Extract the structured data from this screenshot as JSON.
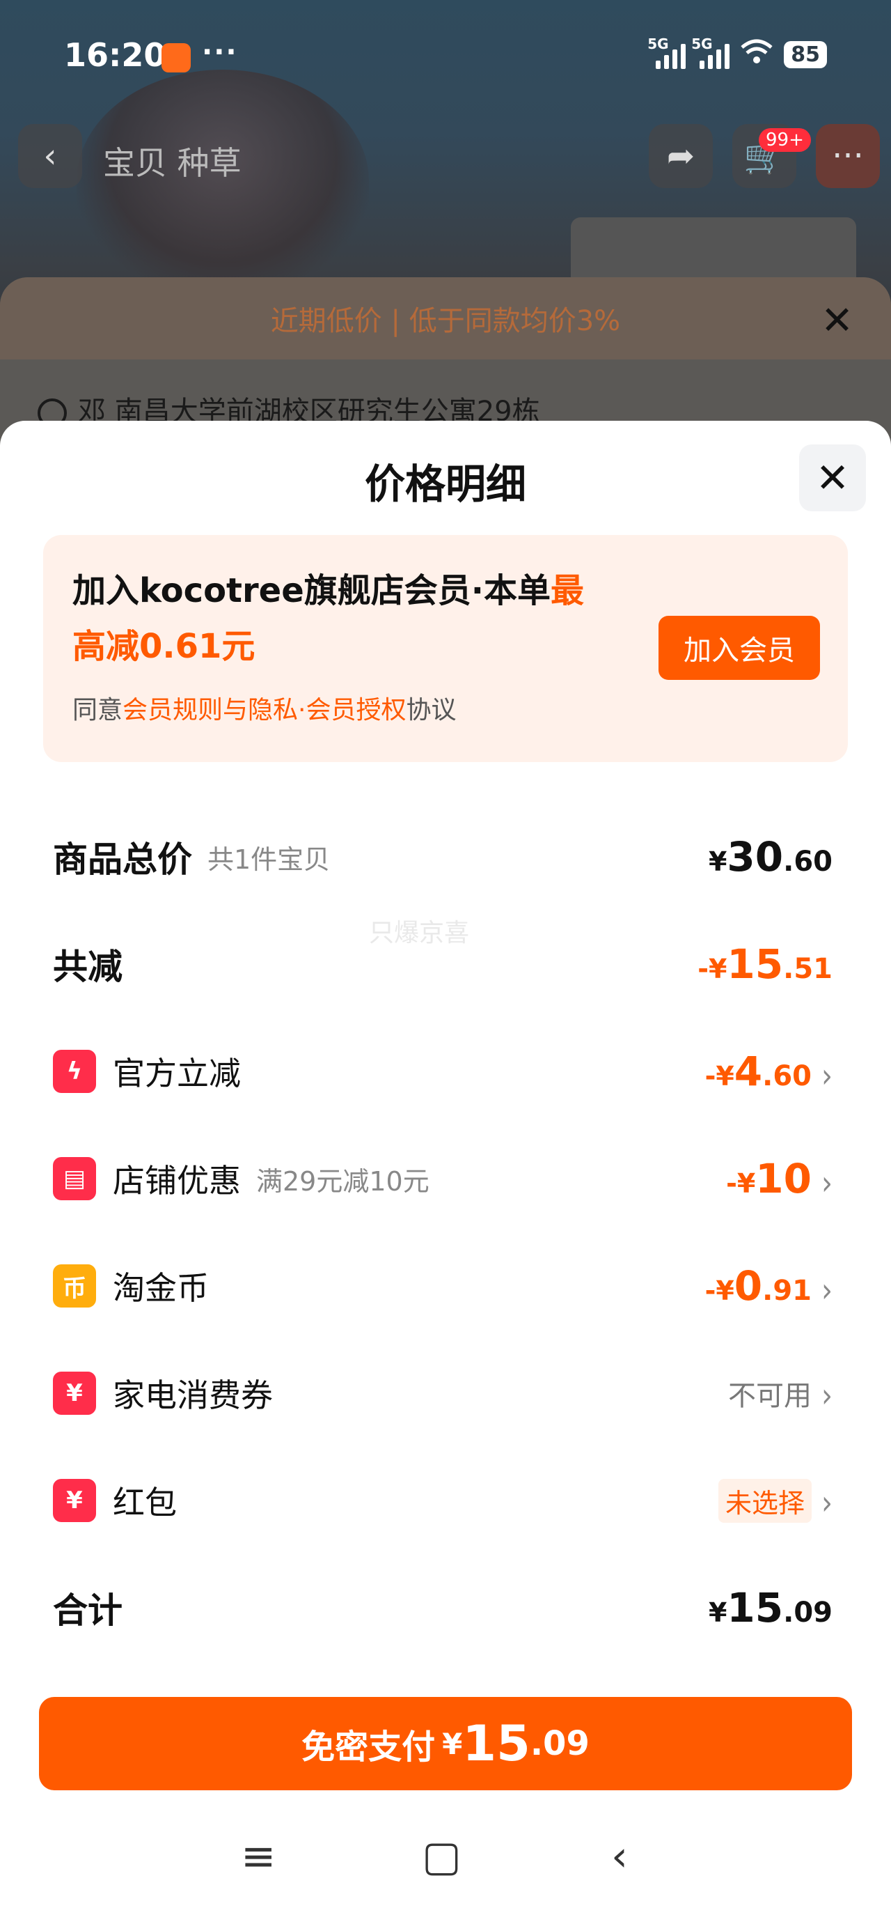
{
  "status_bar": {
    "time": "16:20",
    "dots": "···",
    "sim1": "5G",
    "sim2": "5G",
    "battery": "85"
  },
  "background": {
    "tabs": "宝贝  种草",
    "cart_badge": "99+",
    "promo": "近期低价 | 低于同款均价3%",
    "address": "邓 南昌大学前湖校区研究生公寓29栋"
  },
  "sheet": {
    "title": "价格明细",
    "member": {
      "line1_prefix": "加入kocotree旗舰店会员·本单",
      "line1_highlight": "最",
      "line2": "高减0.61元",
      "agree_prefix": "同意",
      "agree_link": "会员规则与隐私·会员授权",
      "agree_suffix": "协议",
      "join_button": "加入会员"
    },
    "watermark": "只爆京喜",
    "rows": {
      "total": {
        "label": "商品总价",
        "sub": "共1件宝贝",
        "cur": "¥",
        "int": "30",
        "dec": ".60"
      },
      "discount": {
        "label": "共减",
        "cur": "-¥",
        "int": "15",
        "dec": ".51"
      },
      "official": {
        "label": "官方立减",
        "cur": "-¥",
        "int": "4",
        "dec": ".60"
      },
      "shop": {
        "label": "店铺优惠",
        "sub": "满29元减10元",
        "cur": "-¥",
        "int": "10",
        "dec": ""
      },
      "coin": {
        "label": "淘金币",
        "cur": "-¥",
        "int": "0",
        "dec": ".91",
        "icon_char": "币"
      },
      "appliance": {
        "label": "家电消费券",
        "status": "不可用",
        "icon_char": "¥"
      },
      "redpacket": {
        "label": "红包",
        "status": "未选择",
        "icon_char": "¥"
      },
      "sum": {
        "label": "合计",
        "cur": "¥",
        "int": "15",
        "dec": ".09"
      }
    },
    "pay_button": {
      "label": "免密支付",
      "cur": "¥",
      "int": "15",
      "dec": ".09"
    }
  },
  "colors": {
    "accent": "#ff5a00",
    "official_icon": "#ff2d4a",
    "shop_icon": "#ff2d4a",
    "coin_icon": "#ffad0d",
    "appliance_icon": "#ff2d4a",
    "redpacket_icon": "#ff2d4a"
  }
}
